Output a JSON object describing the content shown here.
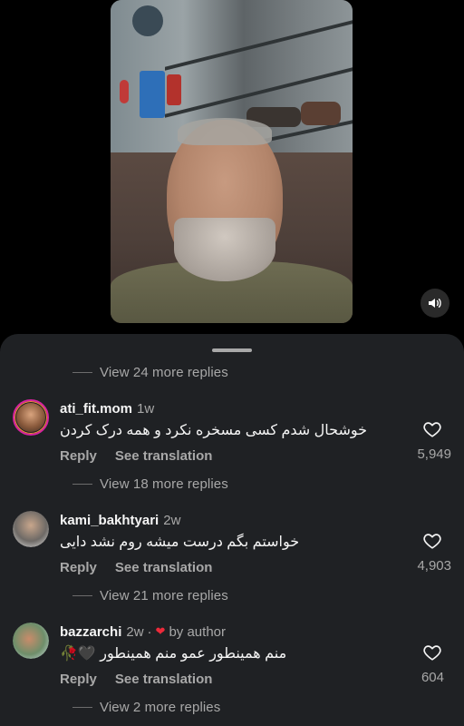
{
  "sound_button": {
    "icon": "speaker-icon"
  },
  "comments": [
    {
      "username": "ati_fit.mom",
      "time": "1w",
      "text": "خوشحال شدم کسی مسخره نکرد و همه درک کردن",
      "reply_label": "Reply",
      "translate_label": "See translation",
      "like_count": "5,949",
      "has_story_ring": true
    },
    {
      "username": "kami_bakhtyari",
      "time": "2w",
      "text": "خواستم بگم درست میشه روم نشد دایی",
      "reply_label": "Reply",
      "translate_label": "See translation",
      "like_count": "4,903",
      "has_story_ring": false
    },
    {
      "username": "bazzarchi",
      "time": "2w",
      "separator": "·",
      "liked_by_author_label": "by author",
      "text": "منم همینطور عمو منم همینطور 🖤🥀",
      "reply_label": "Reply",
      "translate_label": "See translation",
      "like_count": "604",
      "has_story_ring": false
    }
  ],
  "view_more": [
    "View 24 more replies",
    "View 18 more replies",
    "View 21 more replies",
    "View 2 more replies"
  ],
  "colors": {
    "sheet_bg": "#1f2124",
    "secondary_text": "#a8a8a8",
    "heart_red": "#ed2a3a",
    "story_ring": "#d6249f"
  }
}
